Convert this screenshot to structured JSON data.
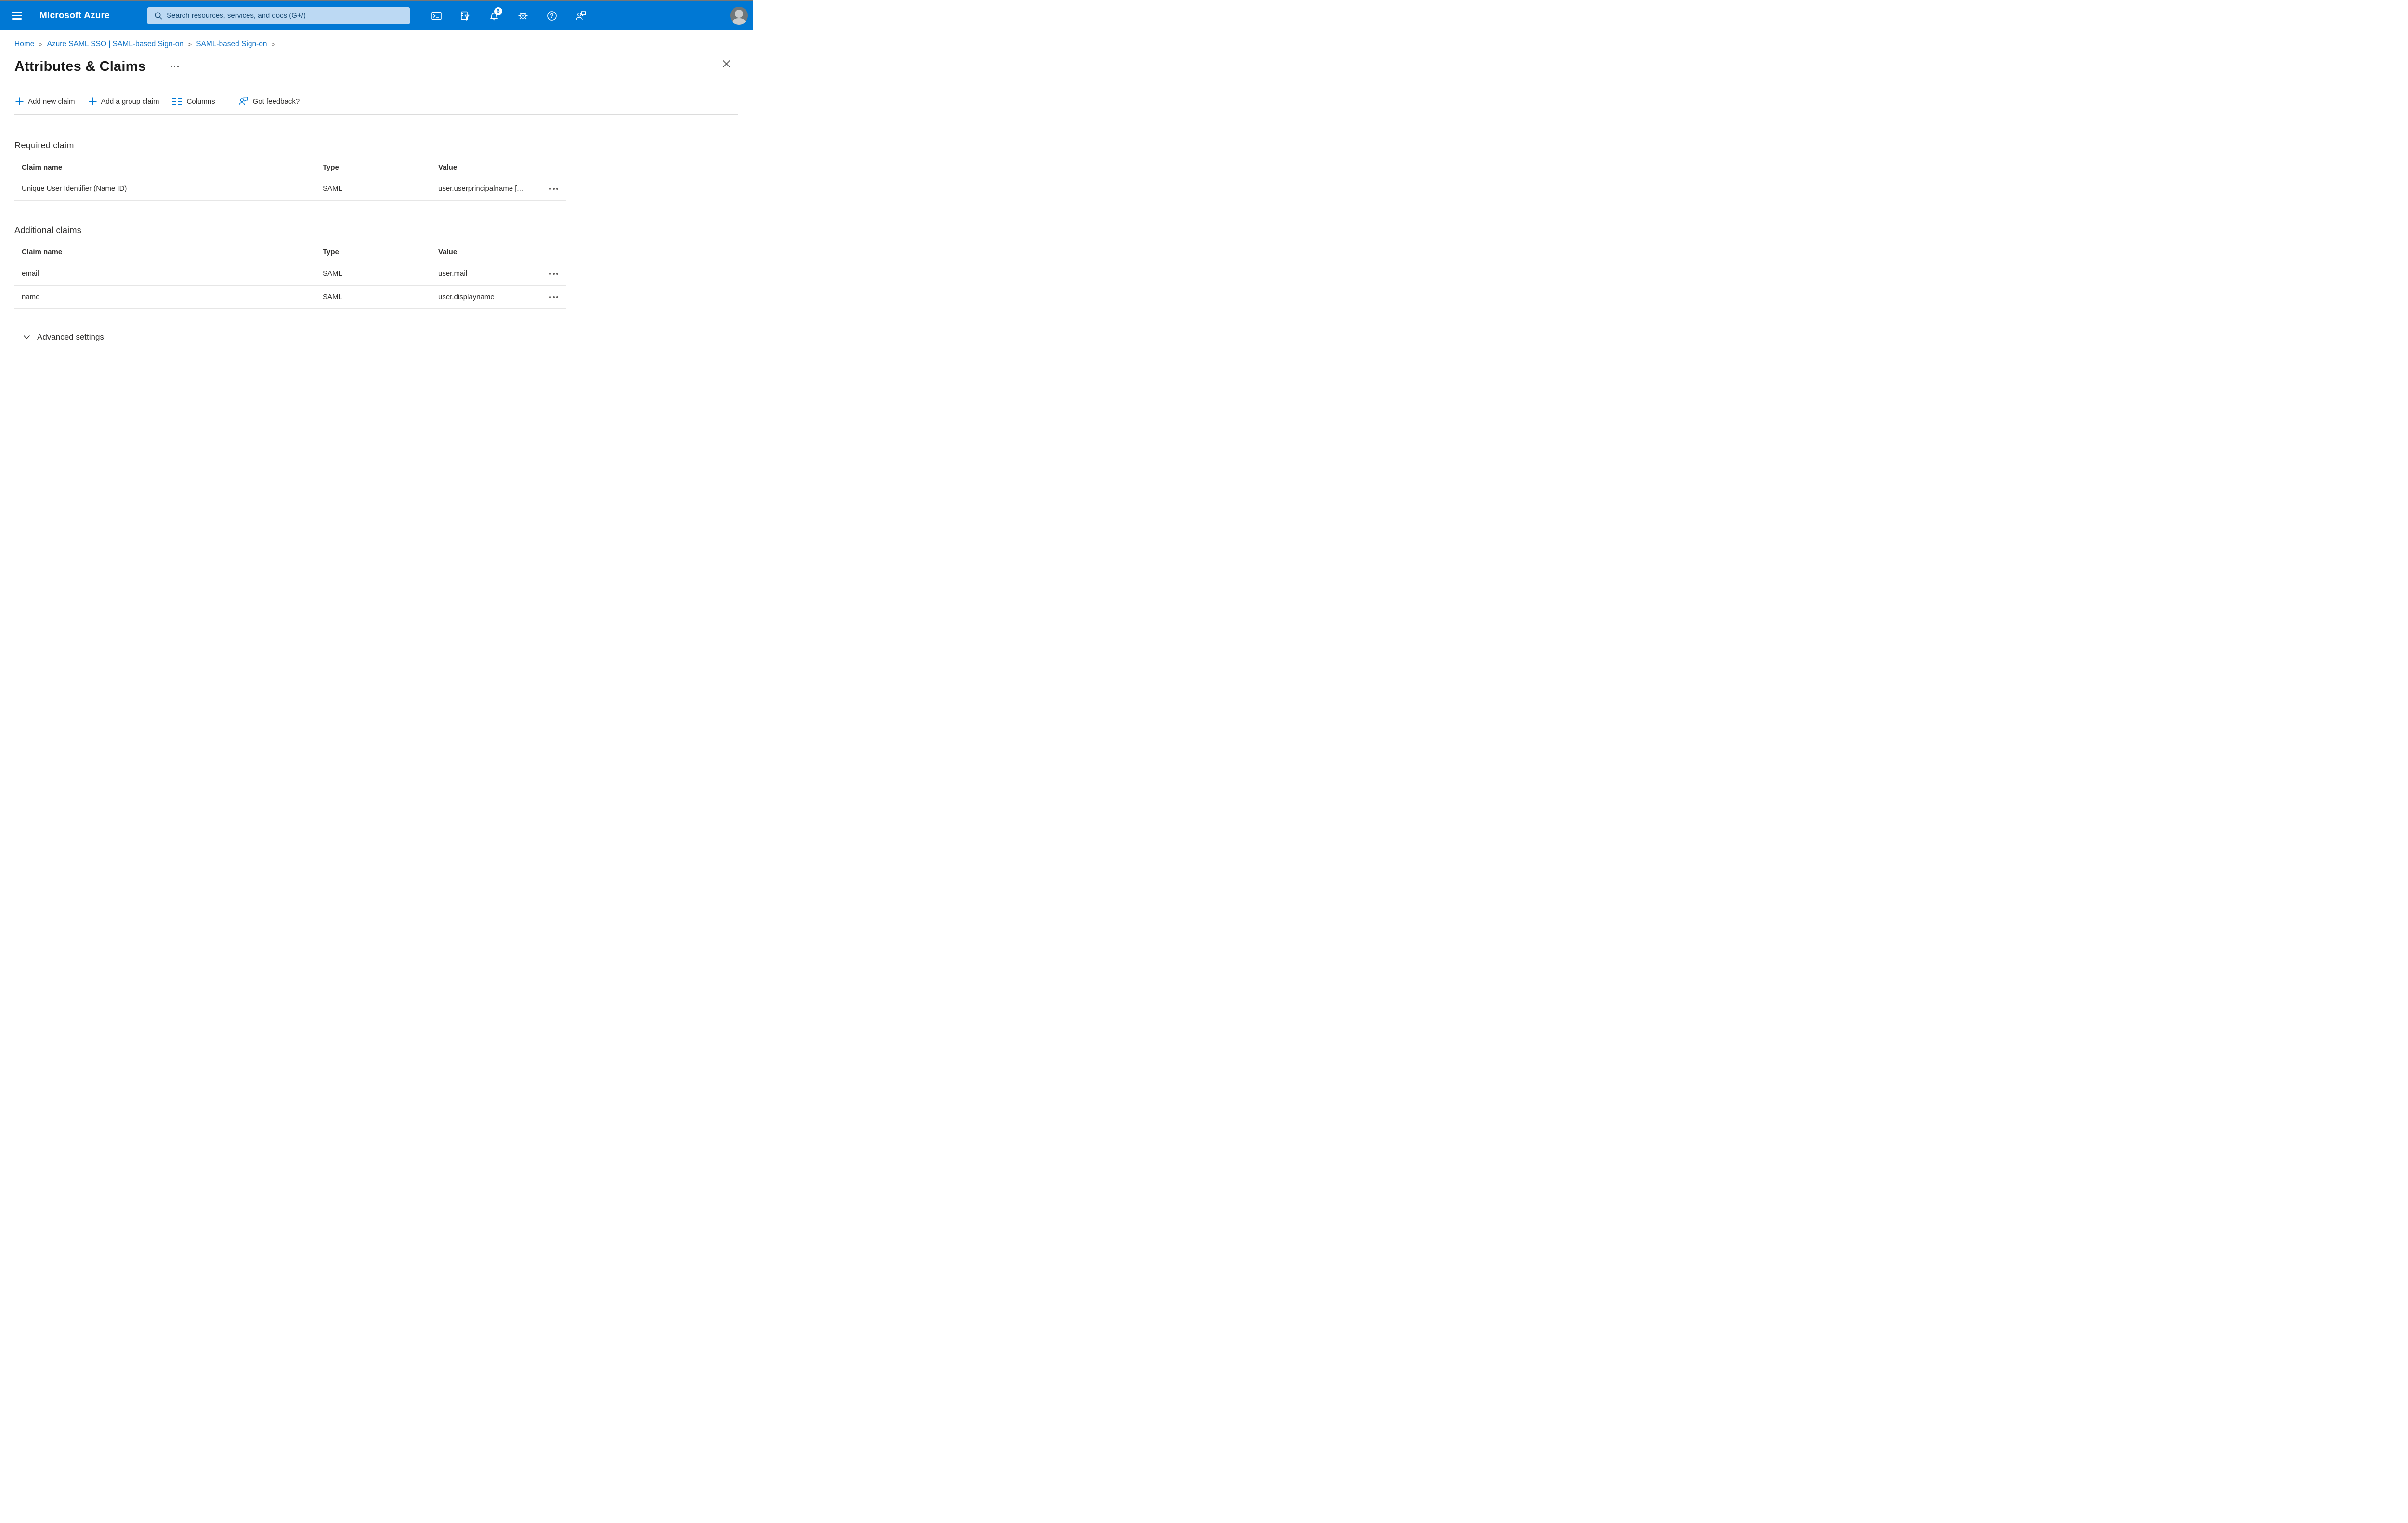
{
  "topbar": {
    "brand": "Microsoft Azure",
    "search_placeholder": "Search resources, services, and docs (G+/)",
    "notification_count": "6",
    "icons": [
      "cloud-shell",
      "directory-filter",
      "notifications",
      "settings",
      "help",
      "feedback"
    ],
    "colors": {
      "bar": "#0078d4",
      "search_bg": "#bcd9f3",
      "search_text": "#1b4c74"
    }
  },
  "breadcrumb": {
    "separator": ">",
    "items": [
      {
        "label": "Home"
      },
      {
        "label": "Azure SAML SSO | SAML-based Sign-on"
      },
      {
        "label": "SAML-based Sign-on"
      }
    ]
  },
  "page": {
    "title": "Attributes & Claims"
  },
  "toolbar": {
    "add_new_claim": "Add new claim",
    "add_group_claim": "Add a group claim",
    "columns": "Columns",
    "got_feedback": "Got feedback?"
  },
  "required_claim": {
    "heading": "Required claim",
    "columns": [
      "Claim name",
      "Type",
      "Value"
    ],
    "rows": [
      {
        "claim_name": "Unique User Identifier (Name ID)",
        "type": "SAML",
        "value": "user.userprincipalname [..."
      }
    ]
  },
  "additional_claims": {
    "heading": "Additional claims",
    "columns": [
      "Claim name",
      "Type",
      "Value"
    ],
    "rows": [
      {
        "claim_name": "email",
        "type": "SAML",
        "value": "user.mail"
      },
      {
        "claim_name": "name",
        "type": "SAML",
        "value": "user.displayname"
      }
    ]
  },
  "advanced": {
    "label": "Advanced settings"
  },
  "colors": {
    "accent": "#0078d4",
    "link": "#1173c6",
    "text": "#323130",
    "muted": "#605e5c"
  }
}
